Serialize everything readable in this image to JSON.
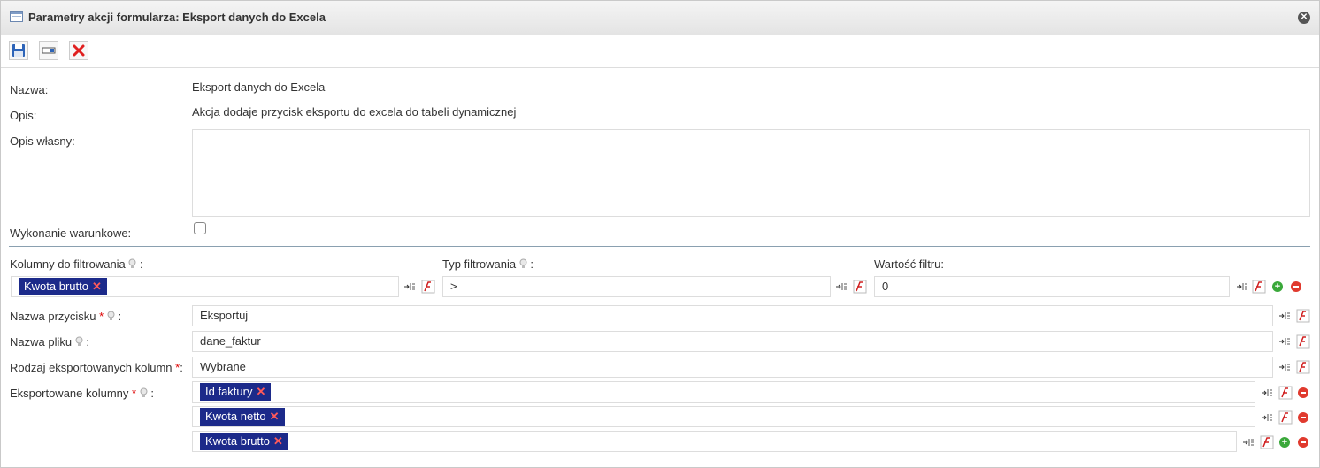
{
  "window": {
    "title": "Parametry akcji formularza: Eksport danych do Excela"
  },
  "fields": {
    "nazwa": {
      "label": "Nazwa:",
      "value": "Eksport danych do Excela"
    },
    "opis": {
      "label": "Opis:",
      "value": "Akcja dodaje przycisk eksportu do excela do tabeli dynamicznej"
    },
    "opis_wlasny": {
      "label": "Opis własny:",
      "value": ""
    },
    "wykonanie": {
      "label": "Wykonanie warunkowe:",
      "checked": false
    }
  },
  "filter": {
    "kolumny_label": "Kolumny do filtrowania",
    "typ_label": "Typ filtrowania",
    "wartosc_label": "Wartość filtru:",
    "colon": ":",
    "kolumny_tag": "Kwota brutto",
    "typ_value": ">",
    "wartosc_value": "0"
  },
  "params": {
    "przycisk_label": "Nazwa przycisku",
    "przycisk_value": "Eksportuj",
    "plik_label": "Nazwa pliku",
    "plik_value": "dane_faktur",
    "rodzaj_label": "Rodzaj eksportowanych kolumn",
    "rodzaj_value": "Wybrane",
    "eksportowane_label": "Eksportowane kolumny",
    "columns": [
      "Id faktury",
      "Kwota netto",
      "Kwota brutto"
    ]
  },
  "marks": {
    "required": "*",
    "remove": "✕",
    "add": "+"
  },
  "icons": [
    "table-icon",
    "close-icon",
    "save-icon",
    "field-icon",
    "delete-icon",
    "hint-icon",
    "map-icon",
    "function-icon",
    "add-icon",
    "remove-icon"
  ]
}
